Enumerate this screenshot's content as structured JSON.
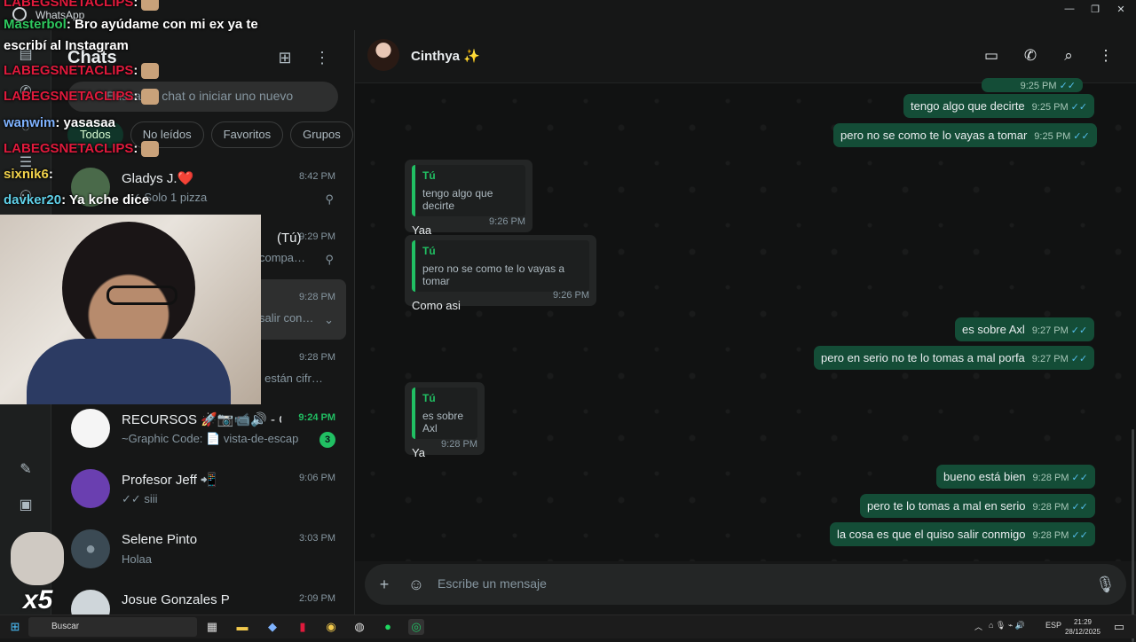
{
  "window": {
    "title": "WhatsApp"
  },
  "chat_list": {
    "title": "Chats",
    "search_placeholder": "Busca un chat o iniciar uno nuevo",
    "filters": [
      "Todos",
      "No leídos",
      "Favoritos",
      "Grupos"
    ],
    "items": [
      {
        "name": "Gladys J.❤️",
        "preview": "✓✓ Solo 1 pizza",
        "time": "8:42 PM",
        "pinned": true
      },
      {
        "name": "(Tú)",
        "preview": "compa…",
        "time": "9:29 PM",
        "pinned": true
      },
      {
        "name": "",
        "preview": "salir con…",
        "time": "9:28 PM"
      },
      {
        "name": "",
        "preview": "s están cifr…",
        "time": "9:28 PM"
      },
      {
        "name": "RECURSOS 🚀📷📹🔊 - Gr...",
        "preview": "~Graphic Code: 📄 vista-de-escapar...",
        "time": "9:24 PM",
        "badge": "3"
      },
      {
        "name": "Profesor Jeff 📲",
        "preview": "✓✓ siii",
        "time": "9:06 PM"
      },
      {
        "name": "Selene Pinto",
        "preview": "Holaa",
        "time": "3:03 PM"
      },
      {
        "name": "Josue Gonzales P",
        "preview": "",
        "time": "2:09 PM"
      }
    ]
  },
  "conversation": {
    "contact": "Cinthya ✨",
    "messages": [
      {
        "dir": "out",
        "text": "tengo algo que decirte",
        "time": "9:25 PM"
      },
      {
        "dir": "out",
        "text": "pero no se como te lo vayas a tomar",
        "time": "9:25 PM"
      },
      {
        "dir": "in",
        "quote_author": "Tú",
        "quote": "tengo algo que decirte",
        "text": "Yaa",
        "time": "9:26 PM"
      },
      {
        "dir": "in",
        "quote_author": "Tú",
        "quote": "pero no se como te lo vayas a tomar",
        "text": "Como asi",
        "time": "9:26 PM"
      },
      {
        "dir": "out",
        "text": "es sobre Axl",
        "time": "9:27 PM"
      },
      {
        "dir": "out",
        "text": "pero en serio no te lo tomas a mal porfa",
        "time": "9:27 PM"
      },
      {
        "dir": "in",
        "quote_author": "Tú",
        "quote": "es sobre Axl",
        "text": "Ya",
        "time": "9:28 PM"
      },
      {
        "dir": "out",
        "text": "bueno está bien",
        "time": "9:28 PM"
      },
      {
        "dir": "out",
        "text": "pero te lo tomas a mal en serio",
        "time": "9:28 PM"
      },
      {
        "dir": "out",
        "text": "la cosa es que el quiso salir conmigo",
        "time": "9:28 PM"
      }
    ],
    "top_partial_time": "9:25 PM",
    "composer_placeholder": "Escribe un mensaje"
  },
  "stream_chat": [
    {
      "user": "LABEGSNETACLIPS",
      "text": ":",
      "color": "#e01a3c"
    },
    {
      "user": "Masterbol",
      "text": ": Bro ayúdame con mi ex ya te",
      "color": "#2ec95e"
    },
    {
      "user": "",
      "text": "escribí al Instagram",
      "color": "#ffffff"
    },
    {
      "user": "LABEGSNETACLIPS",
      "text": ":",
      "color": "#e01a3c"
    },
    {
      "user": "LABEGSNETACLIPS",
      "text": ":",
      "color": "#e01a3c"
    },
    {
      "user": "wanwim",
      "text": ": yasasaa",
      "color": "#7fb3ff"
    },
    {
      "user": "LABEGSNETACLIPS",
      "text": ":",
      "color": "#e01a3c"
    },
    {
      "user": "sixnik6",
      "text": ":",
      "color": "#f2d34b"
    },
    {
      "user": "davker20",
      "text": ": Ya kche dice",
      "color": "#5fd0e8"
    }
  ],
  "overlay": {
    "multiplier": "x5"
  },
  "taskbar": {
    "search": "Buscar",
    "lang": "ESP",
    "time": "21:29",
    "date": "28/12/2025"
  },
  "colors": {
    "accent": "#21c063",
    "outgoing_bubble": "#144d37",
    "incoming_bubble": "#242626",
    "read_ticks": "#53bdeb"
  }
}
